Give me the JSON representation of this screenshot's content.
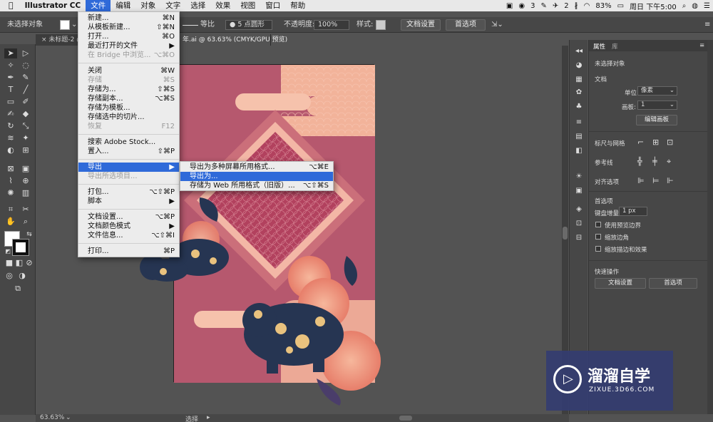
{
  "menubar": {
    "apple": "",
    "app": "Illustrator CC",
    "items": [
      "文件",
      "编辑",
      "对象",
      "文字",
      "选择",
      "效果",
      "视图",
      "窗口",
      "帮助"
    ],
    "status_wechat_count": "3",
    "status_other_count": "2",
    "battery": "83%",
    "clock": "周日 下午5:00"
  },
  "controlbar": {
    "no_selection": "未选择对象",
    "stroke_profile": "等比",
    "brush": "5 点圆形",
    "opacity_label": "不透明度:",
    "opacity_value": "100%",
    "style_label": "样式:",
    "doc_setup": "文档设置",
    "preferences": "首选项"
  },
  "tabs": [
    {
      "label": "未标题-2 @ ..."
    },
    {
      "label": "年.ai @ 63.63% (CMYK/GPU 预览)"
    }
  ],
  "filemenu": {
    "items": [
      {
        "label": "新建...",
        "key": "⌘N",
        "state": "normal"
      },
      {
        "label": "从模板新建...",
        "key": "⇧⌘N",
        "state": "normal"
      },
      {
        "label": "打开...",
        "key": "⌘O",
        "state": "normal"
      },
      {
        "label": "最近打开的文件",
        "key": "▶",
        "state": "normal"
      },
      {
        "label": "在 Bridge 中浏览...",
        "key": "⌥⌘O",
        "state": "disabled"
      },
      {
        "label": "关闭",
        "key": "⌘W",
        "state": "normal"
      },
      {
        "label": "存储",
        "key": "⌘S",
        "state": "disabled"
      },
      {
        "label": "存储为...",
        "key": "⇧⌘S",
        "state": "normal"
      },
      {
        "label": "存储副本...",
        "key": "⌥⌘S",
        "state": "normal"
      },
      {
        "label": "存储为模板...",
        "key": "",
        "state": "normal"
      },
      {
        "label": "存储选中的切片...",
        "key": "",
        "state": "normal"
      },
      {
        "label": "恢复",
        "key": "F12",
        "state": "disabled"
      },
      {
        "label": "搜索 Adobe Stock...",
        "key": "",
        "state": "normal"
      },
      {
        "label": "置入...",
        "key": "⇧⌘P",
        "state": "normal"
      },
      {
        "label": "导出",
        "key": "▶",
        "state": "selected"
      },
      {
        "label": "导出所选项目...",
        "key": "",
        "state": "disabled"
      },
      {
        "label": "打包...",
        "key": "⌥⇧⌘P",
        "state": "normal"
      },
      {
        "label": "脚本",
        "key": "▶",
        "state": "normal"
      },
      {
        "label": "文档设置...",
        "key": "⌥⌘P",
        "state": "normal"
      },
      {
        "label": "文档颜色模式",
        "key": "▶",
        "state": "normal"
      },
      {
        "label": "文件信息...",
        "key": "⌥⇧⌘I",
        "state": "normal"
      },
      {
        "label": "打印...",
        "key": "⌘P",
        "state": "normal"
      }
    ]
  },
  "submenu": {
    "items": [
      {
        "label": "导出为多种屏幕所用格式...",
        "key": "⌥⌘E",
        "state": "normal"
      },
      {
        "label": "导出为...",
        "key": "",
        "state": "selected"
      },
      {
        "label": "存储为 Web 所用格式（旧版）...",
        "key": "⌥⇧⌘S",
        "state": "normal"
      }
    ]
  },
  "panel": {
    "tab_properties": "属性",
    "tab_library": "库",
    "no_selection": "未选择对象",
    "document": "文档",
    "unit_label": "单位:",
    "unit_value": "像素",
    "artboard_label": "画板:",
    "artboard_value": "1",
    "edit_artboards": "编辑画板",
    "rulers_grids": "标尺与网格",
    "guides": "参考线",
    "align": "对齐选项",
    "preferences": "首选项",
    "keyboard_increment_label": "键盘增量:",
    "keyboard_increment_value": "1 px",
    "use_preview_bounds": "使用预览边界",
    "scale_corners": "缩放边角",
    "scale_strokes": "缩放描边和效果",
    "quick_actions": "快速操作",
    "doc_setup_btn": "文档设置",
    "prefs_btn": "首选项"
  },
  "status": {
    "zoom": "63.63%",
    "tool": "选择"
  },
  "watermark": {
    "title": "溜溜自学",
    "url": "ZIXUE.3D66.COM"
  },
  "colors": {
    "menu_highlight": "#2f6ad9",
    "art_background": "#b6586e",
    "art_peach": "#f2b39a",
    "pig_navy": "#263552",
    "flower_coral": "#ef9579"
  }
}
